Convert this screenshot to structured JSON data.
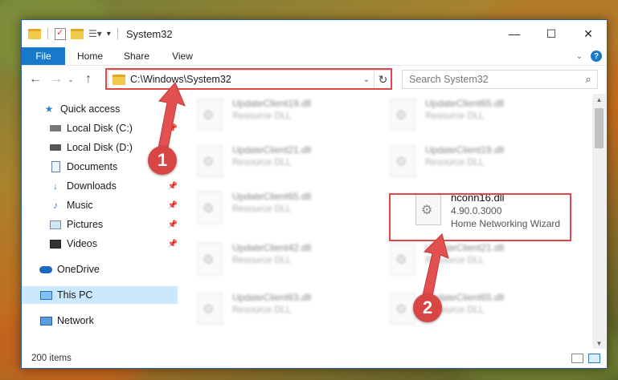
{
  "window": {
    "title": "System32"
  },
  "ribbon": {
    "file": "File",
    "home": "Home",
    "share": "Share",
    "view": "View",
    "help": "?"
  },
  "address": {
    "path": "C:\\Windows\\System32"
  },
  "search": {
    "placeholder": "Search System32"
  },
  "nav": {
    "items": [
      {
        "label": "Quick access"
      },
      {
        "label": "Local Disk (C:)"
      },
      {
        "label": "Local Disk (D:)"
      },
      {
        "label": "Documents"
      },
      {
        "label": "Downloads"
      },
      {
        "label": "Music"
      },
      {
        "label": "Pictures"
      },
      {
        "label": "Videos"
      },
      {
        "label": "OneDrive"
      },
      {
        "label": "This PC"
      },
      {
        "label": "Network"
      }
    ]
  },
  "files": [
    {
      "name": "UpdateClient19.dll",
      "sub": "Resource DLL"
    },
    {
      "name": "UpdateClient65.dll",
      "sub": "Resource DLL"
    },
    {
      "name": "UpdateClient21.dll",
      "sub": "Resource DLL"
    },
    {
      "name": "UpdateClient19.dll",
      "sub": "Resource DLL"
    },
    {
      "name": "UpdateClient65.dll",
      "sub": "Resource DLL"
    },
    {
      "name": "nconn16.dll",
      "version": "4.90.0.3000",
      "sub": "Home Networking Wizard"
    },
    {
      "name": "UpdateClient42.dll",
      "sub": "Resource DLL"
    },
    {
      "name": "UpdateClient21.dll",
      "sub": "Resource DLL"
    },
    {
      "name": "UpdateClient63.dll",
      "sub": "Resource DLL"
    },
    {
      "name": "UpdateClient65.dll",
      "sub": "Resource DLL"
    }
  ],
  "status": {
    "count": "200 items"
  },
  "annotations": {
    "step1": "1",
    "step2": "2"
  },
  "colors": {
    "accent": "#1979ca",
    "highlight": "#e04848",
    "selected": "#cce8ff"
  }
}
